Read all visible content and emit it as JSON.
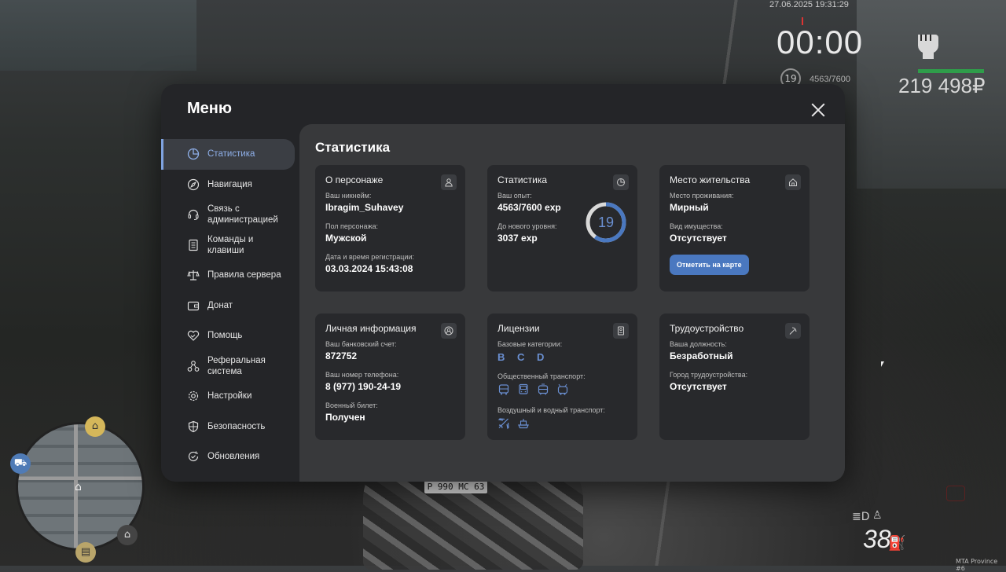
{
  "hud": {
    "datetime": "27.06.2025 19:31:29",
    "timer": "00:00",
    "level": "19",
    "exp": "4563/7600",
    "money": "219 498₽",
    "speed": "38",
    "server": "MTA Province #6"
  },
  "vehicle": {
    "plate": "Р 990 МС 63"
  },
  "menu": {
    "title": "Меню",
    "sidebar": [
      {
        "label": "Статистика",
        "icon": "pie-chart-icon"
      },
      {
        "label": "Навигация",
        "icon": "compass-icon"
      },
      {
        "label": "Связь с\nадминистрацией",
        "icon": "headset-icon"
      },
      {
        "label": "Команды и\nклавиши",
        "icon": "document-icon"
      },
      {
        "label": "Правила сервера",
        "icon": "scales-icon"
      },
      {
        "label": "Донат",
        "icon": "wallet-icon"
      },
      {
        "label": "Помощь",
        "icon": "heart-handshake-icon"
      },
      {
        "label": "Реферальная\nсистема",
        "icon": "people-network-icon"
      },
      {
        "label": "Настройки",
        "icon": "gear-icon"
      },
      {
        "label": "Безопасность",
        "icon": "shield-icon"
      },
      {
        "label": "Обновления",
        "icon": "refresh-check-icon"
      }
    ],
    "active_item": "Статистика"
  },
  "content": {
    "title": "Статистика",
    "character": {
      "title": "О персонаже",
      "nickname_label": "Ваш никнейм:",
      "nickname": "Ibragim_Suhavey",
      "gender_label": "Пол персонажа:",
      "gender": "Мужской",
      "reg_label": "Дата и время регистрации:",
      "reg": "03.03.2024 15:43:08"
    },
    "stats": {
      "title": "Статистика",
      "exp_label": "Ваш опыт:",
      "exp": "4563/7600 exp",
      "next_label": "До нового уровня:",
      "next": "3037 exp",
      "level": "19",
      "progress": 0.6
    },
    "residence": {
      "title": "Место жительства",
      "place_label": "Место проживания:",
      "place": "Мирный",
      "property_label": "Вид имущества:",
      "property": "Отсутствует",
      "map_button": "Отметить на карте"
    },
    "personal": {
      "title": "Личная информация",
      "bank_label": "Ваш банковский счет:",
      "bank": "872752",
      "phone_label": "Ваш номер телефона:",
      "phone": "8 (977) 190-24-19",
      "military_label": "Военный билет:",
      "military": "Получен"
    },
    "licenses": {
      "title": "Лицензии",
      "base_label": "Базовые категории:",
      "base": "B C D",
      "public_label": "Общественный транспорт:",
      "public_icons": [
        "bus-icon",
        "bus-front-icon",
        "tram-icon",
        "trolleybus-icon"
      ],
      "air_water_label": "Воздушный и водный транспорт:",
      "air_water_icons": [
        "plane-icon",
        "ship-icon"
      ]
    },
    "employment": {
      "title": "Трудоустройство",
      "position_label": "Ваша должность:",
      "position": "Безработный",
      "city_label": "Город трудоустройства:",
      "city": "Отсутствует"
    }
  },
  "colors": {
    "accent": "#4a78c0",
    "accent_text": "#6a8fd1",
    "panel": "#28292c",
    "content_bg": "#38393b",
    "menu_bg": "#242528"
  }
}
